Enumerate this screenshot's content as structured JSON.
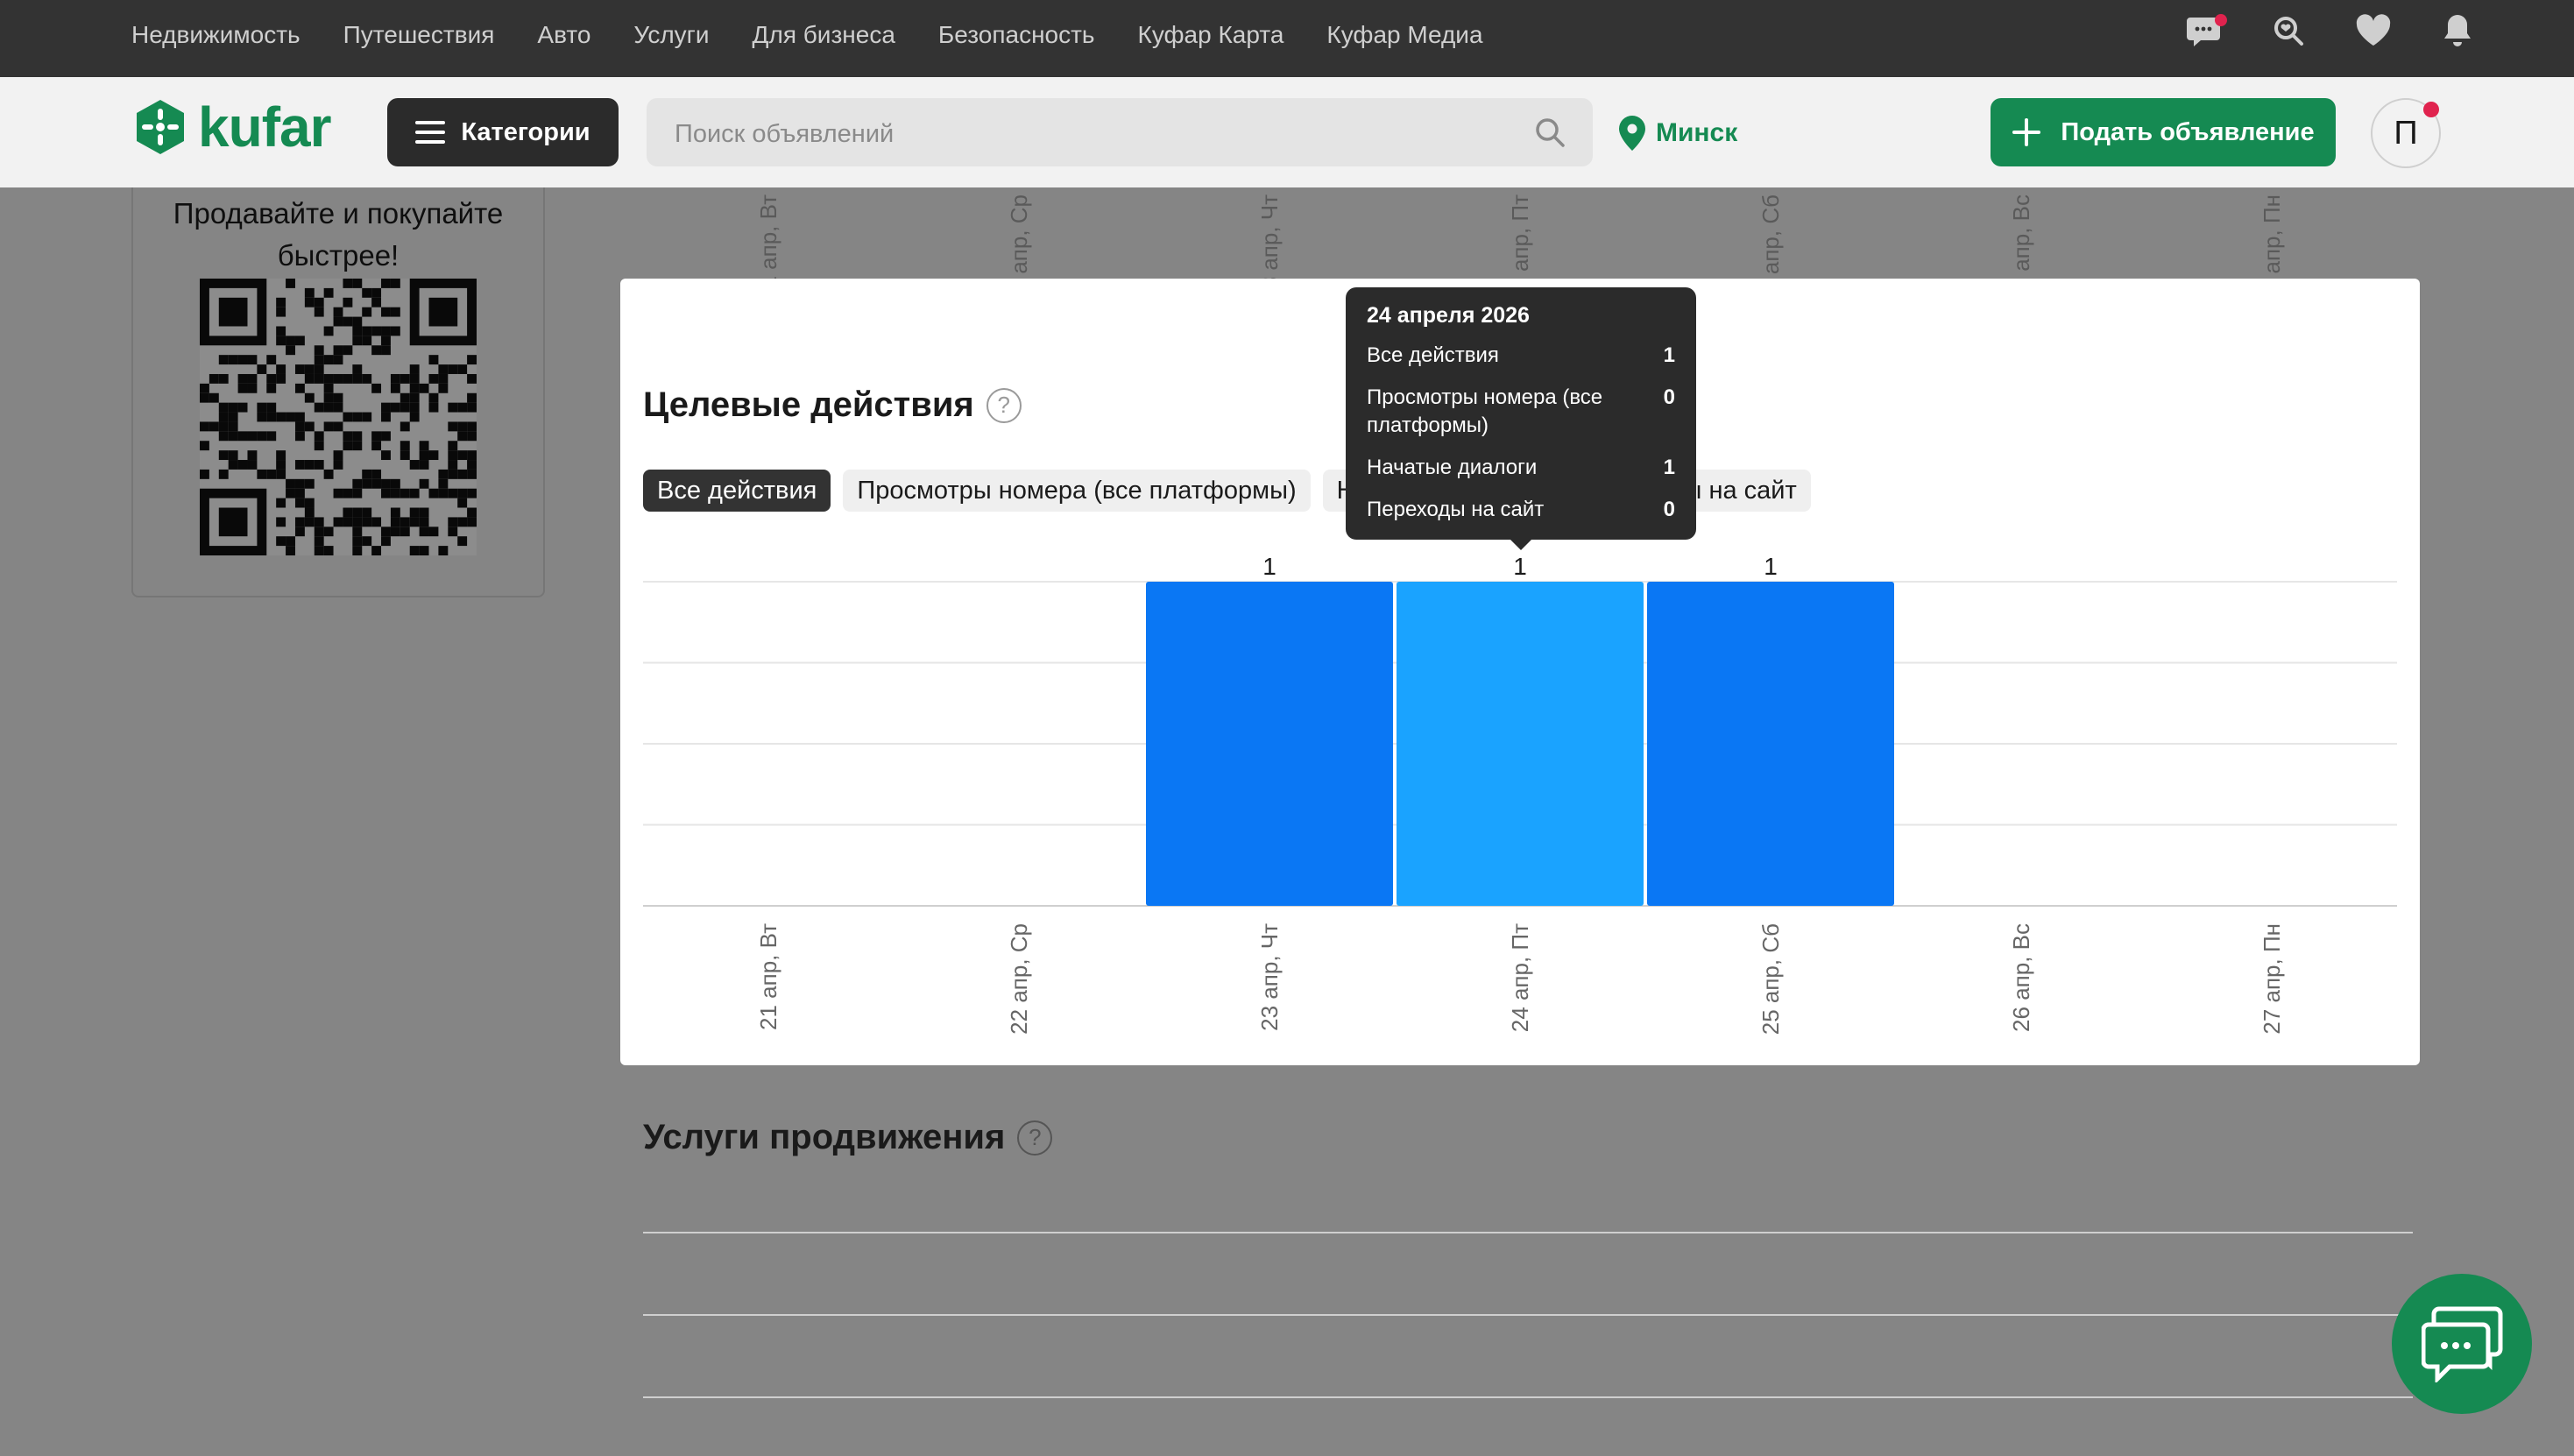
{
  "topnav": {
    "links": [
      "Недвижимость",
      "Путешествия",
      "Авто",
      "Услуги",
      "Для бизнеса",
      "Безопасность",
      "Куфар Карта",
      "Куфар Медиа"
    ],
    "icons": [
      "messages-icon",
      "saved-search-icon",
      "favorites-icon",
      "notifications-icon"
    ]
  },
  "header": {
    "logo_text": "kufar",
    "categories_label": "Категории",
    "search_placeholder": "Поиск объявлений",
    "city": "Минск",
    "post_ad_label": "Подать объявление",
    "avatar_letter": "П"
  },
  "promo": {
    "text": "Продавайте и покупайте быстрее!"
  },
  "stats": {
    "title": "Целевые действия",
    "help": "?",
    "tabs": [
      "Все действия",
      "Просмотры номера (все платформы)",
      "Начатые диалоги",
      "Переходы на сайт"
    ],
    "active_tab": 0
  },
  "chart_data": {
    "type": "bar",
    "categories": [
      "21 апр, Вт",
      "22 апр, Ср",
      "23 апр, Чт",
      "24 апр, Пт",
      "25 апр, Сб",
      "26 апр, Вс",
      "27 апр, Пн"
    ],
    "values": [
      0,
      0,
      1,
      1,
      1,
      0,
      0
    ],
    "data_labels": [
      "",
      "",
      "1",
      "1",
      "1",
      "",
      ""
    ],
    "ylim": [
      0,
      1
    ],
    "grid": true,
    "highlighted_index": 3,
    "colors": {
      "bar": "#0a77f4",
      "bar_hover": "#1aa3ff",
      "grid": "#e6e6e6"
    }
  },
  "tooltip": {
    "title": "24 апреля 2026",
    "rows": [
      {
        "label": "Все действия",
        "value": "1"
      },
      {
        "label": "Просмотры номера (все платформы)",
        "value": "0"
      },
      {
        "label": "Начатые диалоги",
        "value": "1"
      },
      {
        "label": "Переходы на сайт",
        "value": "0"
      }
    ]
  },
  "promo_services": {
    "title": "Услуги продвижения",
    "help": "?"
  },
  "colors": {
    "brand": "#158a52",
    "topnav_bg": "#333333",
    "overlay": "rgba(0,0,0,0.45)"
  }
}
